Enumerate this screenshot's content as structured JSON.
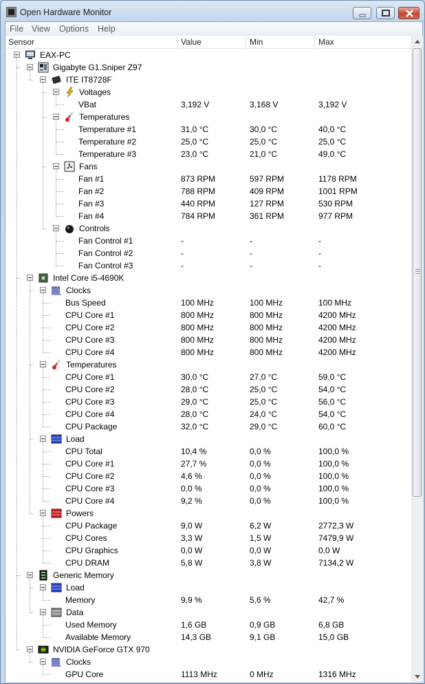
{
  "window": {
    "title": "Open Hardware Monitor"
  },
  "menu": [
    "File",
    "View",
    "Options",
    "Help"
  ],
  "columns": {
    "sensor": "Sensor",
    "value": "Value",
    "min": "Min",
    "max": "Max"
  },
  "rows": [
    {
      "name": "EAX-PC",
      "value": "",
      "min": "",
      "max": "",
      "icon": "computer-icon",
      "level": 0,
      "exp": true
    },
    {
      "name": "Gigabyte G1.Sniper Z97",
      "value": "",
      "min": "",
      "max": "",
      "icon": "motherboard-icon",
      "level": 1,
      "exp": true
    },
    {
      "name": "ITE IT8728F",
      "value": "",
      "min": "",
      "max": "",
      "icon": "chip-icon",
      "level": 2,
      "exp": true
    },
    {
      "name": "Voltages",
      "value": "",
      "min": "",
      "max": "",
      "icon": "voltage-icon",
      "level": 3,
      "exp": true
    },
    {
      "name": "VBat",
      "value": "3,192 V",
      "min": "3,168 V",
      "max": "3,192 V",
      "icon": "",
      "level": 4,
      "exp": false
    },
    {
      "name": "Temperatures",
      "value": "",
      "min": "",
      "max": "",
      "icon": "thermometer-icon",
      "level": 3,
      "exp": true
    },
    {
      "name": "Temperature #1",
      "value": "31,0 °C",
      "min": "30,0 °C",
      "max": "40,0 °C",
      "icon": "",
      "level": 4,
      "exp": false
    },
    {
      "name": "Temperature #2",
      "value": "25,0 °C",
      "min": "25,0 °C",
      "max": "25,0 °C",
      "icon": "",
      "level": 4,
      "exp": false
    },
    {
      "name": "Temperature #3",
      "value": "23,0 °C",
      "min": "21,0 °C",
      "max": "49,0 °C",
      "icon": "",
      "level": 4,
      "exp": false
    },
    {
      "name": "Fans",
      "value": "",
      "min": "",
      "max": "",
      "icon": "fan-icon",
      "level": 3,
      "exp": true
    },
    {
      "name": "Fan #1",
      "value": "873 RPM",
      "min": "597 RPM",
      "max": "1178 RPM",
      "icon": "",
      "level": 4,
      "exp": false
    },
    {
      "name": "Fan #2",
      "value": "788 RPM",
      "min": "409 RPM",
      "max": "1001 RPM",
      "icon": "",
      "level": 4,
      "exp": false
    },
    {
      "name": "Fan #3",
      "value": "440 RPM",
      "min": "127 RPM",
      "max": "530 RPM",
      "icon": "",
      "level": 4,
      "exp": false
    },
    {
      "name": "Fan #4",
      "value": "784 RPM",
      "min": "361 RPM",
      "max": "977 RPM",
      "icon": "",
      "level": 4,
      "exp": false
    },
    {
      "name": "Controls",
      "value": "",
      "min": "",
      "max": "",
      "icon": "control-icon",
      "level": 3,
      "exp": true
    },
    {
      "name": "Fan Control #1",
      "value": "-",
      "min": "-",
      "max": "-",
      "icon": "",
      "level": 4,
      "exp": false
    },
    {
      "name": "Fan Control #2",
      "value": "-",
      "min": "-",
      "max": "-",
      "icon": "",
      "level": 4,
      "exp": false
    },
    {
      "name": "Fan Control #3",
      "value": "-",
      "min": "-",
      "max": "-",
      "icon": "",
      "level": 4,
      "exp": false
    },
    {
      "name": "Intel Core i5-4690K",
      "value": "",
      "min": "",
      "max": "",
      "icon": "cpu-icon",
      "level": 1,
      "exp": true
    },
    {
      "name": "Clocks",
      "value": "",
      "min": "",
      "max": "",
      "icon": "clock-icon",
      "level": 2,
      "exp": true
    },
    {
      "name": "Bus Speed",
      "value": "100 MHz",
      "min": "100 MHz",
      "max": "100 MHz",
      "icon": "",
      "level": 3,
      "exp": false
    },
    {
      "name": "CPU Core #1",
      "value": "800 MHz",
      "min": "800 MHz",
      "max": "4200 MHz",
      "icon": "",
      "level": 3,
      "exp": false
    },
    {
      "name": "CPU Core #2",
      "value": "800 MHz",
      "min": "800 MHz",
      "max": "4200 MHz",
      "icon": "",
      "level": 3,
      "exp": false
    },
    {
      "name": "CPU Core #3",
      "value": "800 MHz",
      "min": "800 MHz",
      "max": "4200 MHz",
      "icon": "",
      "level": 3,
      "exp": false
    },
    {
      "name": "CPU Core #4",
      "value": "800 MHz",
      "min": "800 MHz",
      "max": "4200 MHz",
      "icon": "",
      "level": 3,
      "exp": false
    },
    {
      "name": "Temperatures",
      "value": "",
      "min": "",
      "max": "",
      "icon": "thermometer-icon",
      "level": 2,
      "exp": true
    },
    {
      "name": "CPU Core #1",
      "value": "30,0 °C",
      "min": "27,0 °C",
      "max": "59,0 °C",
      "icon": "",
      "level": 3,
      "exp": false
    },
    {
      "name": "CPU Core #2",
      "value": "28,0 °C",
      "min": "25,0 °C",
      "max": "54,0 °C",
      "icon": "",
      "level": 3,
      "exp": false
    },
    {
      "name": "CPU Core #3",
      "value": "29,0 °C",
      "min": "25,0 °C",
      "max": "56,0 °C",
      "icon": "",
      "level": 3,
      "exp": false
    },
    {
      "name": "CPU Core #4",
      "value": "28,0 °C",
      "min": "24,0 °C",
      "max": "54,0 °C",
      "icon": "",
      "level": 3,
      "exp": false
    },
    {
      "name": "CPU Package",
      "value": "32,0 °C",
      "min": "29,0 °C",
      "max": "60,0 °C",
      "icon": "",
      "level": 3,
      "exp": false
    },
    {
      "name": "Load",
      "value": "",
      "min": "",
      "max": "",
      "icon": "load-icon",
      "level": 2,
      "exp": true
    },
    {
      "name": "CPU Total",
      "value": "10,4 %",
      "min": "0,0 %",
      "max": "100,0 %",
      "icon": "",
      "level": 3,
      "exp": false
    },
    {
      "name": "CPU Core #1",
      "value": "27,7 %",
      "min": "0,0 %",
      "max": "100,0 %",
      "icon": "",
      "level": 3,
      "exp": false
    },
    {
      "name": "CPU Core #2",
      "value": "4,6 %",
      "min": "0,0 %",
      "max": "100,0 %",
      "icon": "",
      "level": 3,
      "exp": false
    },
    {
      "name": "CPU Core #3",
      "value": "0,0 %",
      "min": "0,0 %",
      "max": "100,0 %",
      "icon": "",
      "level": 3,
      "exp": false
    },
    {
      "name": "CPU Core #4",
      "value": "9,2 %",
      "min": "0,0 %",
      "max": "100,0 %",
      "icon": "",
      "level": 3,
      "exp": false
    },
    {
      "name": "Powers",
      "value": "",
      "min": "",
      "max": "",
      "icon": "power-icon",
      "level": 2,
      "exp": true
    },
    {
      "name": "CPU Package",
      "value": "9,0 W",
      "min": "6,2 W",
      "max": "2772,3 W",
      "icon": "",
      "level": 3,
      "exp": false
    },
    {
      "name": "CPU Cores",
      "value": "3,3 W",
      "min": "1,5 W",
      "max": "7479,9 W",
      "icon": "",
      "level": 3,
      "exp": false
    },
    {
      "name": "CPU Graphics",
      "value": "0,0 W",
      "min": "0,0 W",
      "max": "0,0 W",
      "icon": "",
      "level": 3,
      "exp": false
    },
    {
      "name": "CPU DRAM",
      "value": "5,8 W",
      "min": "3,8 W",
      "max": "7134,2 W",
      "icon": "",
      "level": 3,
      "exp": false
    },
    {
      "name": "Generic Memory",
      "value": "",
      "min": "",
      "max": "",
      "icon": "memory-icon",
      "level": 1,
      "exp": true
    },
    {
      "name": "Load",
      "value": "",
      "min": "",
      "max": "",
      "icon": "load-icon",
      "level": 2,
      "exp": true
    },
    {
      "name": "Memory",
      "value": "9,9 %",
      "min": "5,6 %",
      "max": "42,7 %",
      "icon": "",
      "level": 3,
      "exp": false
    },
    {
      "name": "Data",
      "value": "",
      "min": "",
      "max": "",
      "icon": "data-icon",
      "level": 2,
      "exp": true
    },
    {
      "name": "Used Memory",
      "value": "1,6 GB",
      "min": "0,9 GB",
      "max": "6,8 GB",
      "icon": "",
      "level": 3,
      "exp": false
    },
    {
      "name": "Available Memory",
      "value": "14,3 GB",
      "min": "9,1 GB",
      "max": "15,0 GB",
      "icon": "",
      "level": 3,
      "exp": false
    },
    {
      "name": "NVIDIA GeForce GTX 970",
      "value": "",
      "min": "",
      "max": "",
      "icon": "gpu-icon",
      "level": 1,
      "exp": true
    },
    {
      "name": "Clocks",
      "value": "",
      "min": "",
      "max": "",
      "icon": "clock-icon",
      "level": 2,
      "exp": true
    },
    {
      "name": "GPU Core",
      "value": "1113 MHz",
      "min": "0 MHz",
      "max": "1316 MHz",
      "icon": "",
      "level": 3,
      "exp": false
    }
  ]
}
